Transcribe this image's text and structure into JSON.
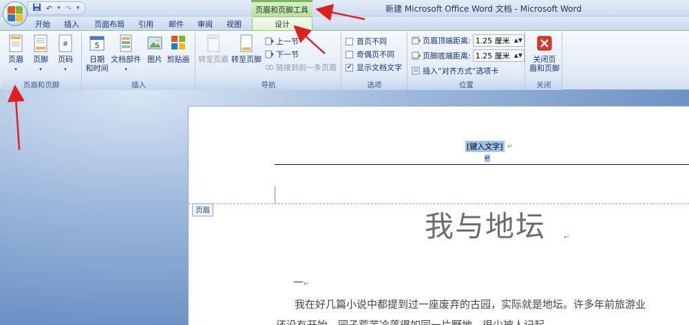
{
  "window": {
    "context_tab_group": "页眉和页脚工具",
    "title": "新建 Microsoft Office Word 文档 - Microsoft Word"
  },
  "qat": {
    "undo_glyph": "↶",
    "redo_glyph": "↷",
    "save_icon": "save-icon",
    "customize_glyph": "▾"
  },
  "tabs": [
    "开始",
    "插入",
    "页面布局",
    "引用",
    "邮件",
    "审阅",
    "视图"
  ],
  "active_tab": "设计",
  "ribbon": {
    "header_footer": {
      "header": "页眉",
      "footer": "页脚",
      "page_number": "页码",
      "label": "页眉和页脚"
    },
    "insert": {
      "date_time_1": "日期",
      "date_time_2": "和时间",
      "quick_parts": "文档部件",
      "picture": "图片",
      "clipart": "剪贴画",
      "label": "插入"
    },
    "navigation": {
      "goto_header": "转至页眉",
      "goto_footer": "转至页脚",
      "prev_section": "上一节",
      "next_section": "下一节",
      "link_previous": "链接到前一条页眉",
      "label": "导航"
    },
    "options": {
      "different_first": "首页不同",
      "different_odd_even": "奇偶页不同",
      "show_doc_text": "显示文档文字",
      "label": "选项"
    },
    "position": {
      "header_top_label": "页眉顶端距离:",
      "header_top_value": "1.25 厘米",
      "footer_bottom_label": "页脚底端距离:",
      "footer_bottom_value": "1.25 厘米",
      "insert_align_tab": "插入“对齐方式”选项卡",
      "label": "位置"
    },
    "close": {
      "line1": "关闭页",
      "line2": "眉和页脚",
      "label": "关闭"
    }
  },
  "document": {
    "header_placeholder": "[键入文字]",
    "header_tag": "页眉",
    "title": "我与地坛",
    "section_mark": "一",
    "para1": "我在好几篇小说中都提到过一座废弃的古园，实际就是地坛。许多年前旅游业",
    "para2": "还没有开始，园子荒芜冷落得如同一片野地，很少被人记起。"
  },
  "colors": {
    "accent_green": "#78b85a",
    "annotation_red": "#e02020",
    "selection": "#9cc2ec"
  }
}
